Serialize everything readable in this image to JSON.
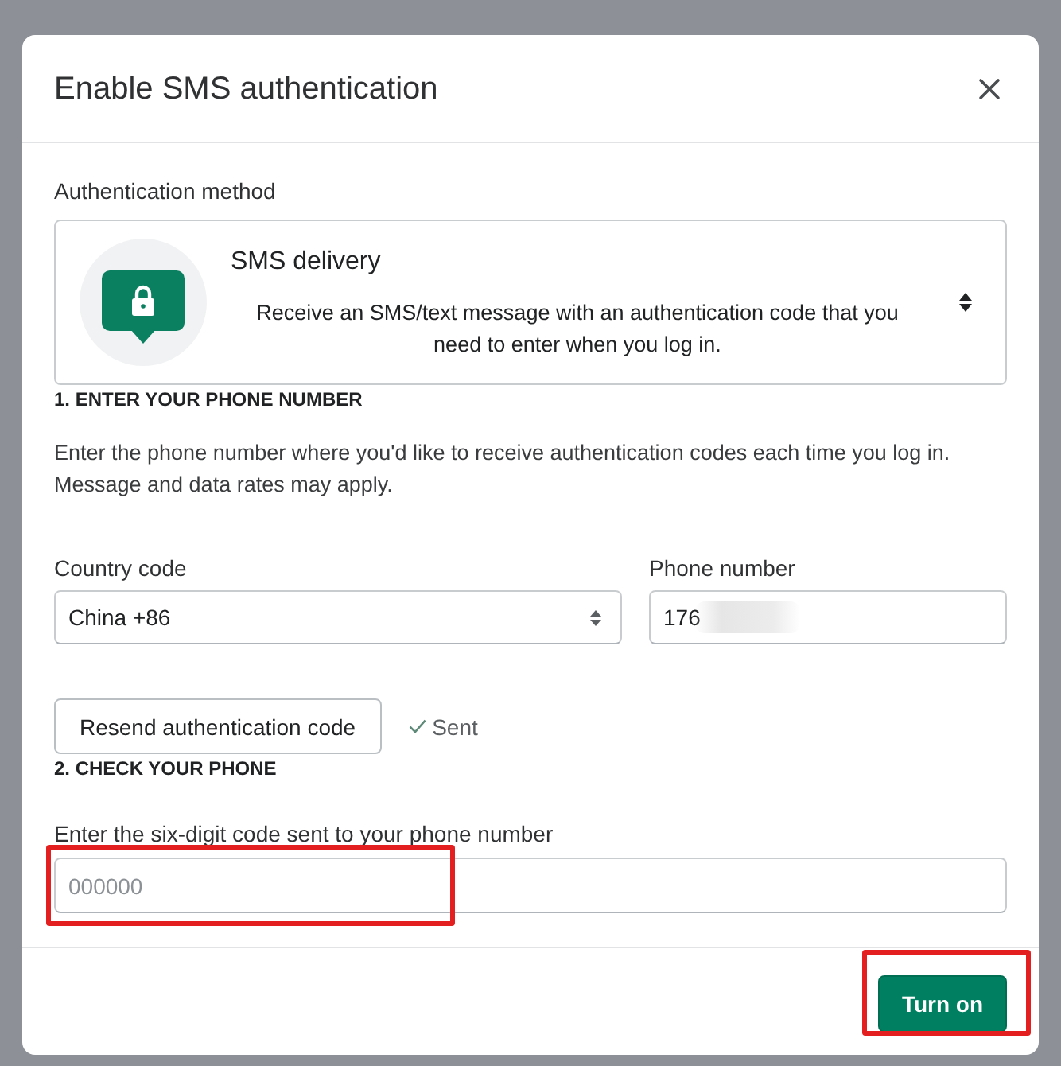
{
  "dialog": {
    "title": "Enable SMS authentication"
  },
  "method": {
    "label": "Authentication method",
    "title": "SMS delivery",
    "description": "Receive an SMS/text message with an authentication code that you need to enter when you log in."
  },
  "step_1": {
    "heading": "1. ENTER YOUR PHONE NUMBER",
    "instructions": "Enter the phone number where you'd like to receive authentication codes each time you log in. Message and data rates may apply."
  },
  "country_code": {
    "label": "Country code",
    "value": "China +86"
  },
  "phone_number": {
    "label": "Phone number",
    "value": "176",
    "redacted": true
  },
  "resend": {
    "label": "Resend authentication code",
    "status": "Sent",
    "sent": true
  },
  "step_2": {
    "heading": "2. CHECK YOUR PHONE"
  },
  "code_field": {
    "label": "Enter the six-digit code sent to your phone number",
    "placeholder": "000000",
    "highlighted": true
  },
  "footer": {
    "buttons": [
      {
        "label": "Turn on",
        "kind": "primary",
        "highlighted": true
      }
    ]
  }
}
